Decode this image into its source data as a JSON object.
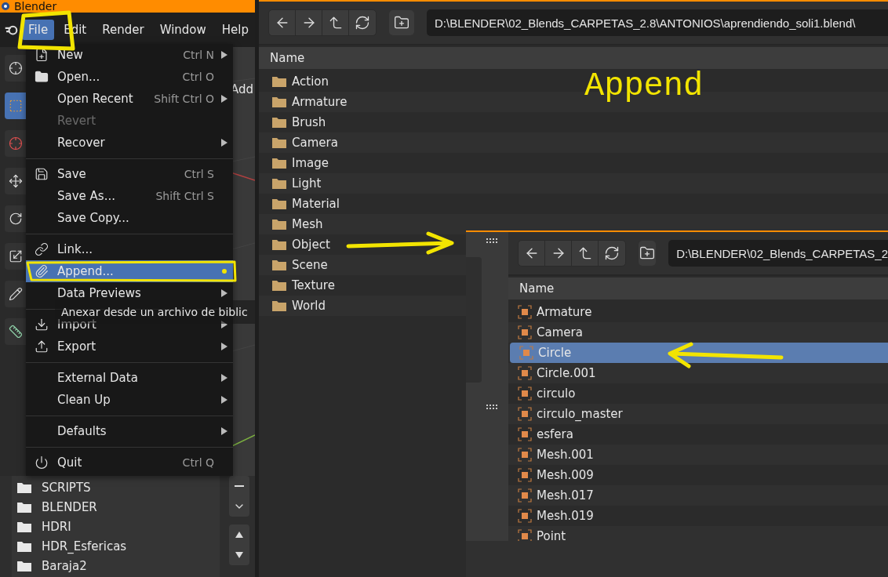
{
  "blender_window": {
    "title": "Blender",
    "menus": [
      {
        "label": "File",
        "selected": true
      },
      {
        "label": "Edit",
        "selected": false
      },
      {
        "label": "Render",
        "selected": false
      },
      {
        "label": "Window",
        "selected": false
      },
      {
        "label": "Help",
        "selected": false
      }
    ],
    "viewport_menu": "Add",
    "file_menu": [
      {
        "kind": "item",
        "label": "New",
        "shortcut": "Ctrl N",
        "submenu": true,
        "disabled": false,
        "selected": false
      },
      {
        "kind": "item",
        "label": "Open...",
        "shortcut": "Ctrl O",
        "submenu": false,
        "disabled": false,
        "selected": false
      },
      {
        "kind": "item",
        "label": "Open Recent",
        "shortcut": "Shift Ctrl O",
        "submenu": true,
        "disabled": false,
        "selected": false
      },
      {
        "kind": "item",
        "label": "Revert",
        "submenu": false,
        "disabled": true,
        "selected": false
      },
      {
        "kind": "item",
        "label": "Recover",
        "submenu": true,
        "disabled": false,
        "selected": false
      },
      {
        "kind": "separator"
      },
      {
        "kind": "item",
        "label": "Save",
        "shortcut": "Ctrl S",
        "submenu": false,
        "disabled": false,
        "selected": false
      },
      {
        "kind": "item",
        "label": "Save As...",
        "shortcut": "Shift Ctrl S",
        "submenu": false,
        "disabled": false,
        "selected": false
      },
      {
        "kind": "item",
        "label": "Save Copy...",
        "submenu": false,
        "disabled": false,
        "selected": false
      },
      {
        "kind": "separator"
      },
      {
        "kind": "item",
        "label": "Link...",
        "submenu": false,
        "disabled": false,
        "selected": false
      },
      {
        "kind": "item",
        "label": "Append...",
        "submenu": false,
        "disabled": false,
        "selected": true
      },
      {
        "kind": "item",
        "label": "Data Previews",
        "submenu": true,
        "disabled": false,
        "selected": false
      },
      {
        "kind": "separator"
      },
      {
        "kind": "item",
        "label": "Import",
        "submenu": true,
        "disabled": false,
        "selected": false
      },
      {
        "kind": "item",
        "label": "Export",
        "submenu": true,
        "disabled": false,
        "selected": false
      },
      {
        "kind": "separator"
      },
      {
        "kind": "item",
        "label": "External Data",
        "submenu": true,
        "disabled": false,
        "selected": false
      },
      {
        "kind": "item",
        "label": "Clean Up",
        "submenu": true,
        "disabled": false,
        "selected": false
      },
      {
        "kind": "separator"
      },
      {
        "kind": "item",
        "label": "Defaults",
        "submenu": true,
        "disabled": false,
        "selected": false
      },
      {
        "kind": "separator"
      },
      {
        "kind": "item",
        "label": "Quit",
        "shortcut": "Ctrl Q",
        "submenu": false,
        "disabled": false,
        "selected": false
      }
    ],
    "tooltip": "Anexar desde un archivo de biblic",
    "bookmarks": [
      "SCRIPTS",
      "BLENDER",
      "HDRI",
      "HDR_Esfericas",
      "Baraja2"
    ]
  },
  "browser": {
    "path": "D:\\BLENDER\\02_Blends_CARPETAS_2.8\\ANTONIOS\\aprendiendo_soli1.blend\\",
    "column": "Name",
    "folders": [
      "Action",
      "Armature",
      "Brush",
      "Camera",
      "Image",
      "Light",
      "Material",
      "Mesh",
      "Object",
      "Scene",
      "Texture",
      "World"
    ]
  },
  "object_browser": {
    "path": "D:\\BLENDER\\02_Blends_CARPETAS_2",
    "column": "Name",
    "objects": [
      {
        "name": "Armature",
        "selected": false
      },
      {
        "name": "Camera",
        "selected": false
      },
      {
        "name": "Circle",
        "selected": true
      },
      {
        "name": "Circle.001",
        "selected": false
      },
      {
        "name": "circulo",
        "selected": false
      },
      {
        "name": "circulo_master",
        "selected": false
      },
      {
        "name": "esfera",
        "selected": false
      },
      {
        "name": "Mesh.001",
        "selected": false
      },
      {
        "name": "Mesh.009",
        "selected": false
      },
      {
        "name": "Mesh.017",
        "selected": false
      },
      {
        "name": "Mesh.019",
        "selected": false
      },
      {
        "name": "Point",
        "selected": false
      }
    ]
  },
  "annotation": {
    "label": "Append"
  }
}
